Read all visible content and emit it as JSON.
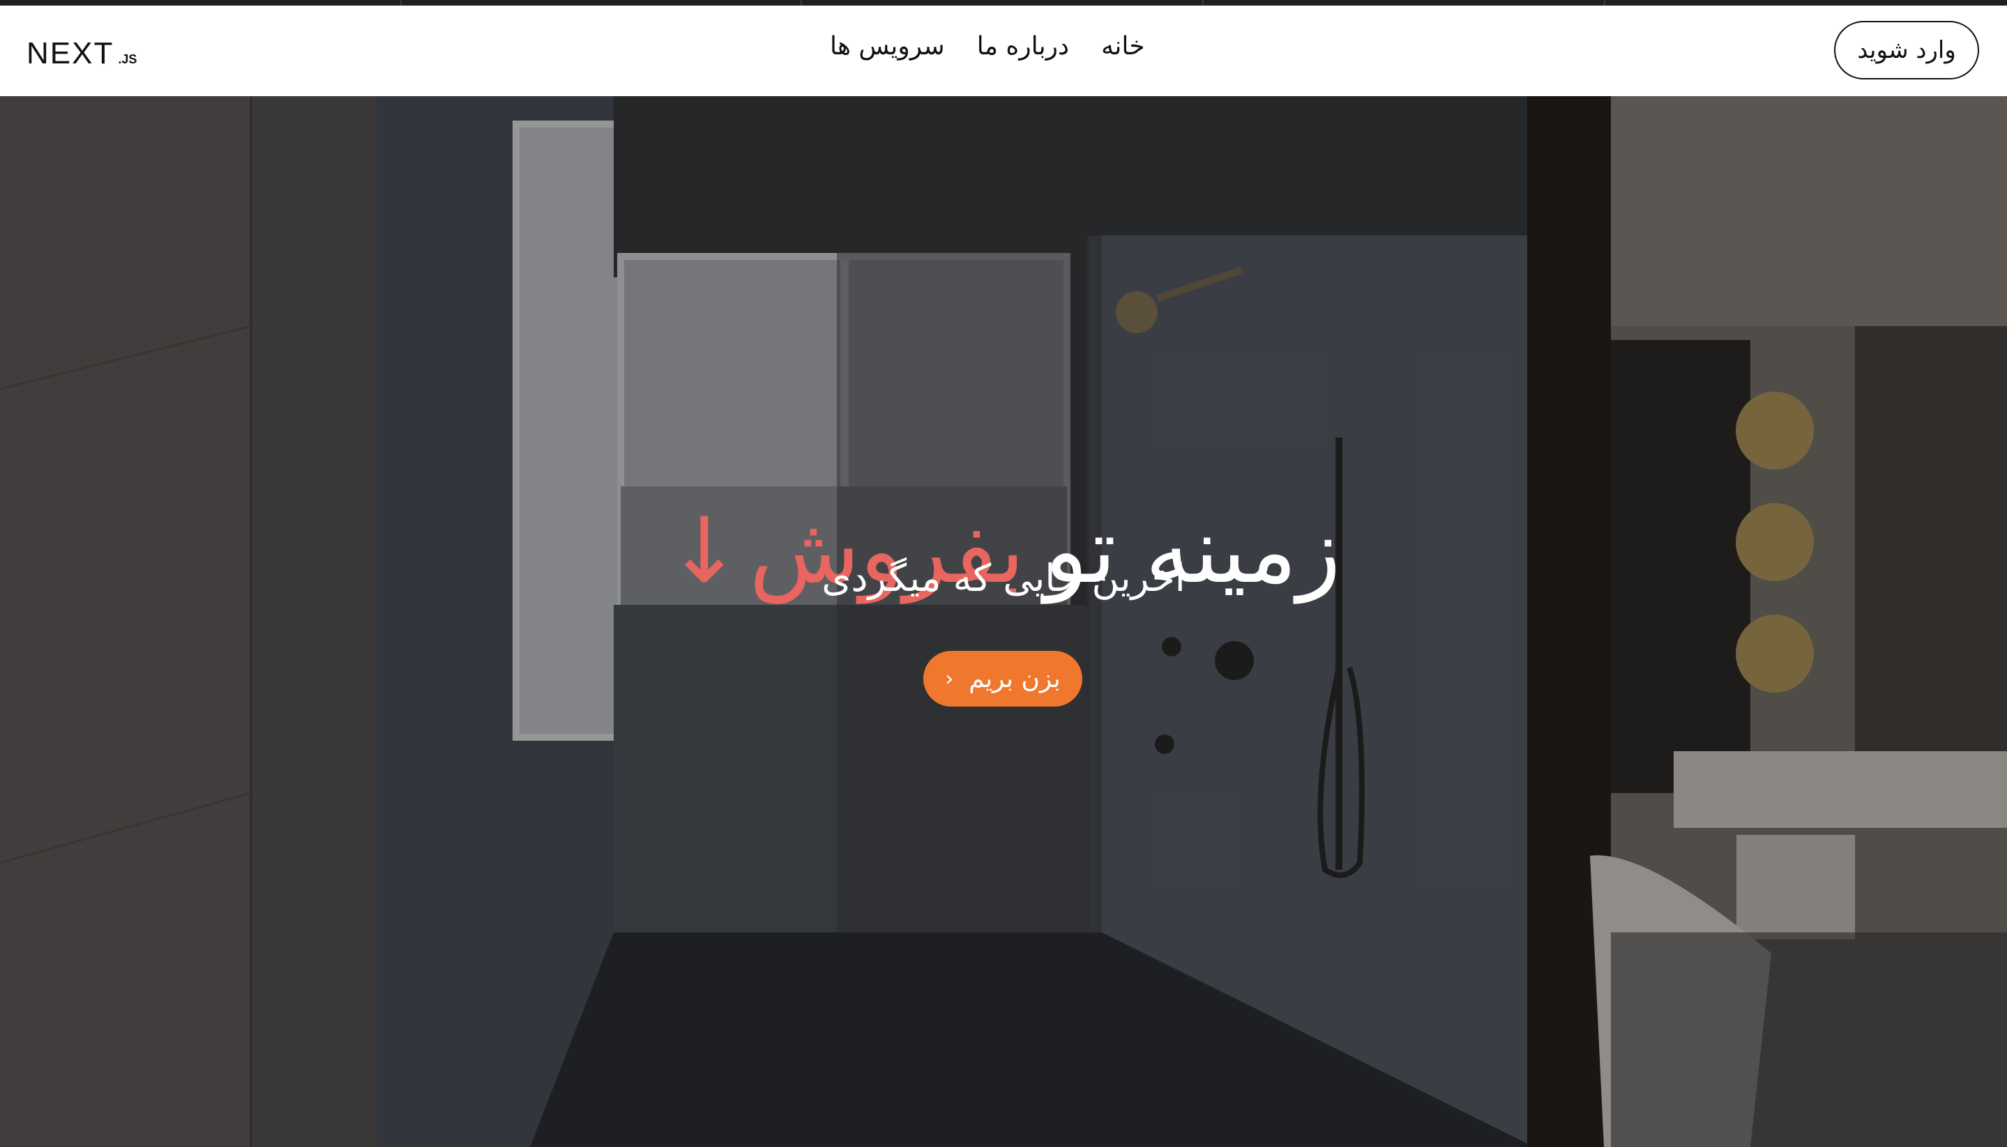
{
  "brand": {
    "logo_main": "NEXT",
    "logo_sub": ".JS"
  },
  "nav": {
    "items": [
      {
        "label": "خانه"
      },
      {
        "label": "درباره ما"
      },
      {
        "label": "سرویس ها"
      }
    ]
  },
  "login_label": "وارد شوید",
  "hero": {
    "title_white": "زمینه تو",
    "title_accent": "بفروش",
    "title_arrow": "↓",
    "subtitle": "اخرین جایی که میگردی",
    "cta_label": "بزن بریم",
    "cta_icon": "chevron-left-icon"
  },
  "colors": {
    "accent": "#e8665f",
    "cta": "#f0782e",
    "header_bg": "#ffffff"
  }
}
